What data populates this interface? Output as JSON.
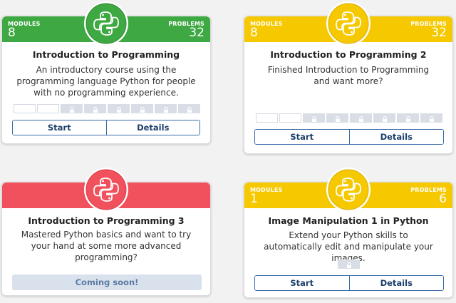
{
  "colors": {
    "green": "#3ea842",
    "yellow": "#f5c800",
    "red": "#f0515c",
    "button_border": "#3a6ba8",
    "button_text": "#1d3f6b"
  },
  "cards": [
    {
      "header_color": "green",
      "modules_label": "MODULES",
      "modules_value": "8",
      "problems_label": "PROBLEMS",
      "problems_value": "32",
      "logo": "python-logo-icon",
      "title": "Introduction to Programming",
      "description": "An introductory course using the programming language Python for people with no programming experience.",
      "progress": {
        "total": 8,
        "unlocked": 2
      },
      "start_label": "Start",
      "details_label": "Details"
    },
    {
      "header_color": "yellow",
      "modules_label": "MODULES",
      "modules_value": "8",
      "problems_label": "PROBLEMS",
      "problems_value": "32",
      "logo": "python-logo-icon",
      "title": "Introduction to Programming 2",
      "description": "Finished Introduction to Programming and want more?",
      "progress": {
        "total": 8,
        "unlocked": 2
      },
      "start_label": "Start",
      "details_label": "Details"
    },
    {
      "header_color": "red",
      "logo": "python-logo-icon",
      "title": "Introduction to Programming 3",
      "description": "Mastered Python basics and want to try your hand at some more advanced programming?",
      "coming_soon_label": "Coming soon!"
    },
    {
      "header_color": "yellow",
      "modules_label": "MODULES",
      "modules_value": "1",
      "problems_label": "PROBLEMS",
      "problems_value": "6",
      "logo": "python-logo-icon",
      "title": "Image Manipulation 1 in Python",
      "description": "Extend your Python skills to automatically edit and manipulate your images.",
      "progress": {
        "total": 1,
        "unlocked": 0
      },
      "start_label": "Start",
      "details_label": "Details"
    }
  ]
}
